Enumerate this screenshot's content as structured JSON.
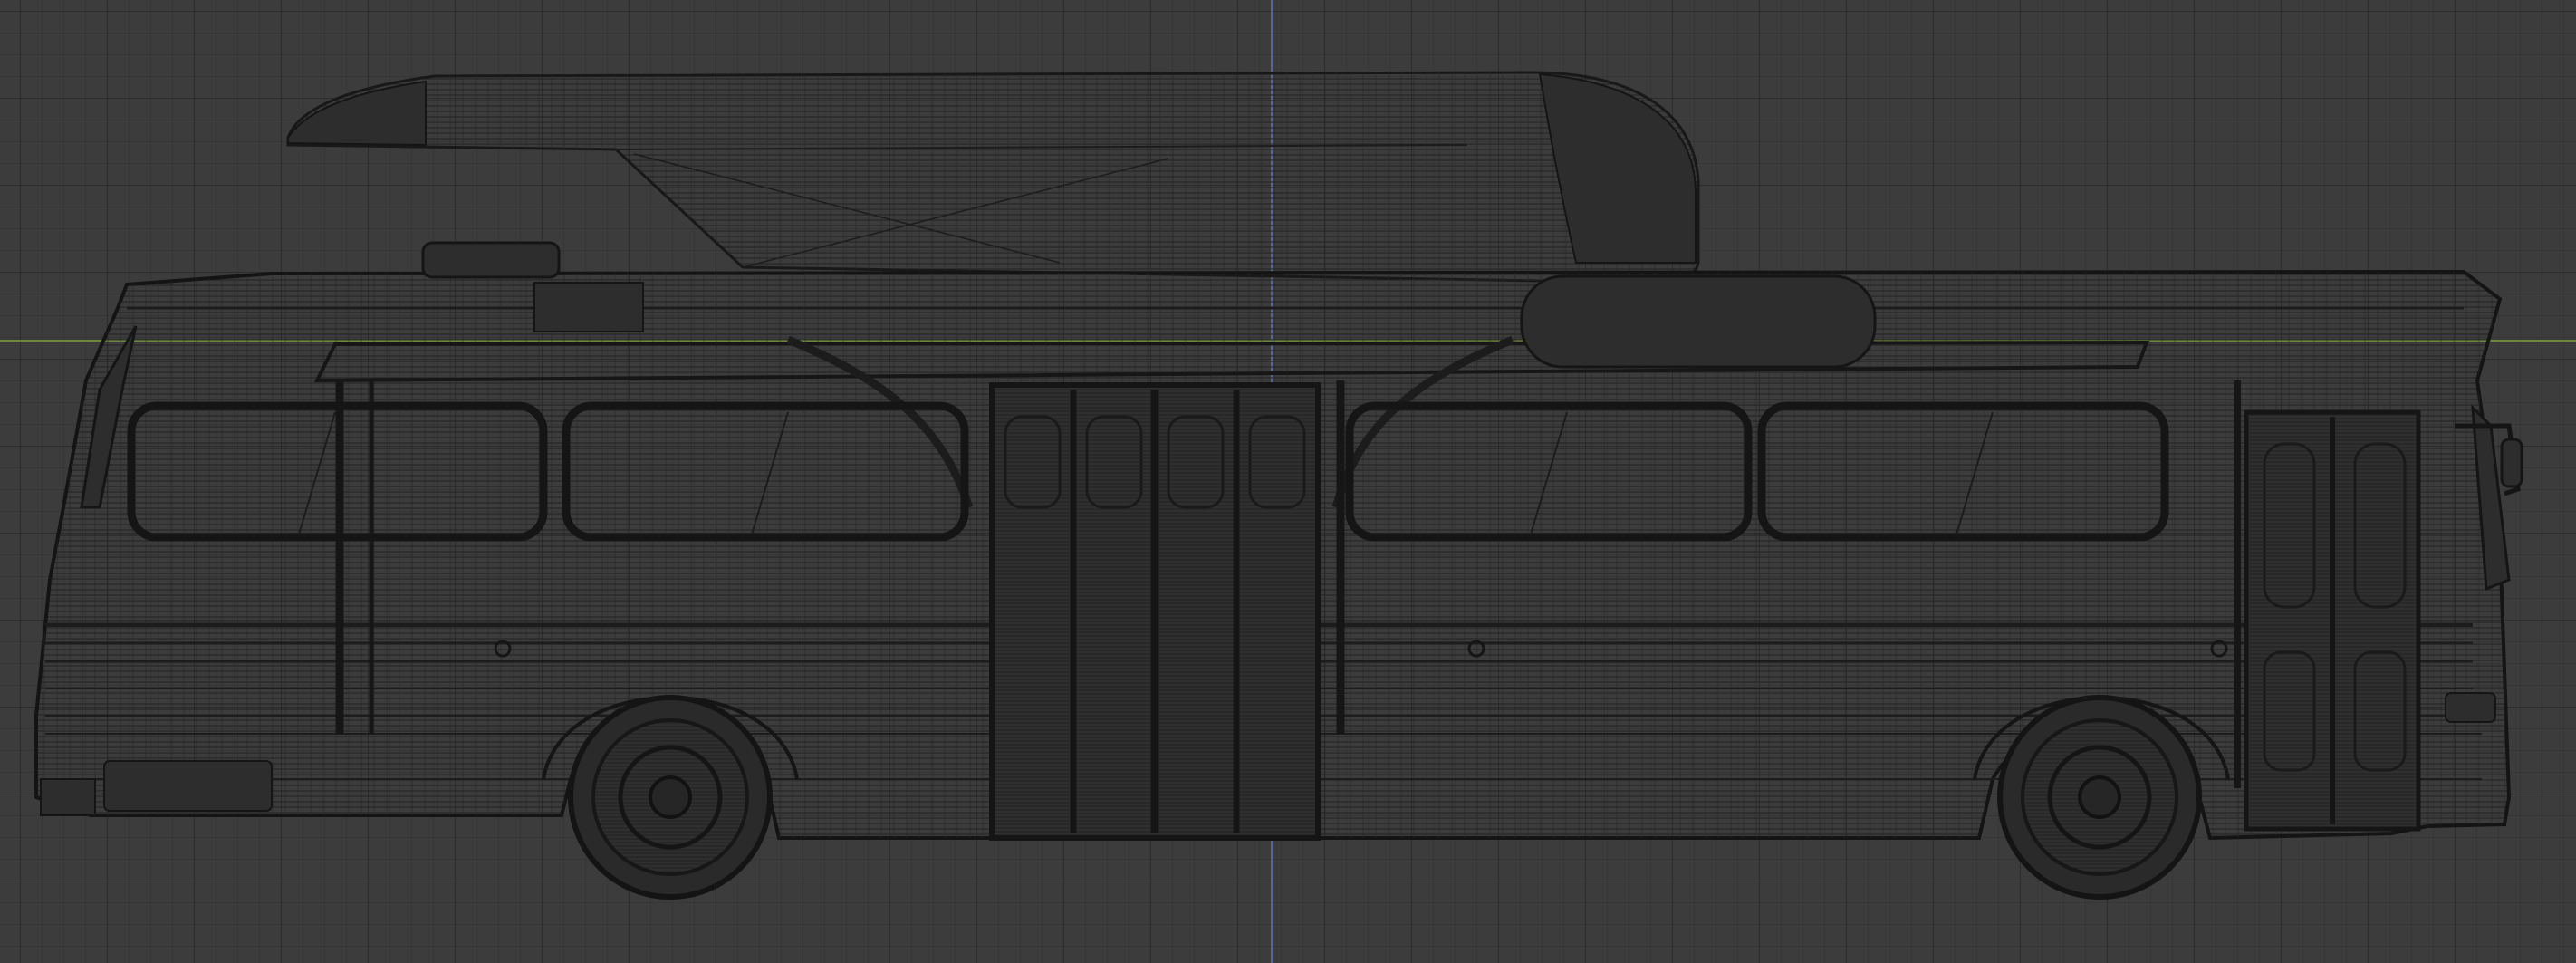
{
  "viewport": {
    "view": "orthographic-side",
    "shading": "wireframe",
    "colors": {
      "background": "#3c3c3c",
      "grid": "#333333",
      "wire": "#1c1c1c",
      "x_axis": "#7fa23a",
      "z_axis": "#5878b8"
    }
  },
  "scene": {
    "object": "bus-wireframe-model",
    "parts": [
      "pantograph-roof-pod",
      "bus-body",
      "windows",
      "doors",
      "front-wheel",
      "rear-wheel",
      "side-mirror"
    ]
  }
}
